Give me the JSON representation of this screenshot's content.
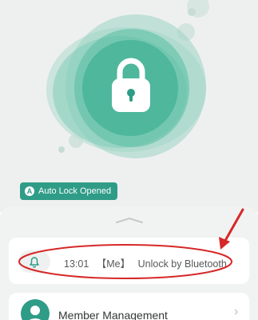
{
  "hero": {
    "lock_icon": "padlock-icon",
    "badge": {
      "icon_letter": "A",
      "label": "Auto Lock Opened"
    }
  },
  "record": {
    "icon": "bell-icon",
    "time": "13:01",
    "user": "【Me】",
    "action": "Unlock by Bluetooth"
  },
  "member": {
    "icon": "person-icon",
    "label": "Member Management",
    "chevron": "›"
  },
  "colors": {
    "accent": "#2f9c87",
    "annotation": "#d62828"
  }
}
